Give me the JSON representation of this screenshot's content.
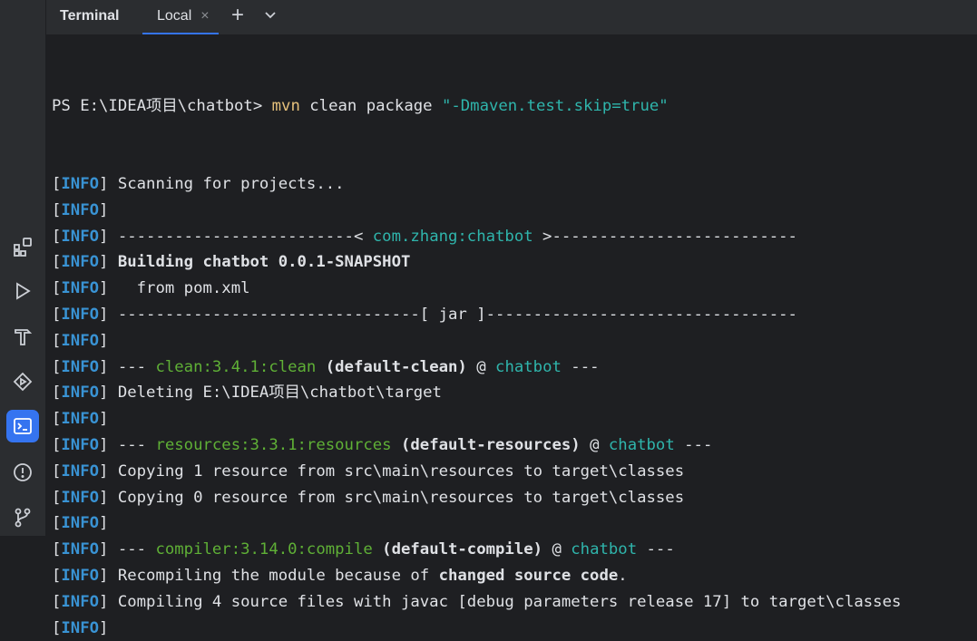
{
  "toolbar": {
    "title": "Terminal",
    "tab_label": "Local",
    "tab_close": "×",
    "add": "+"
  },
  "sidebar": {
    "items": [
      {
        "icon": "structure-icon"
      },
      {
        "icon": "run-icon"
      },
      {
        "icon": "build-icon"
      },
      {
        "icon": "services-icon"
      },
      {
        "icon": "terminal-icon",
        "active": true
      },
      {
        "icon": "problems-icon"
      },
      {
        "icon": "git-icon"
      }
    ]
  },
  "terminal": {
    "prompt": "PS E:\\IDEA项目\\chatbot>",
    "cmd": "mvn",
    "cmd_args": "clean package",
    "cmd_flag": "\"-Dmaven.test.skip=true\"",
    "lines": [
      {
        "tag": "INFO",
        "segments": [
          {
            "t": "Scanning for projects...",
            "c": "n"
          }
        ]
      },
      {
        "tag": "INFO",
        "segments": []
      },
      {
        "tag": "INFO",
        "segments": [
          {
            "t": "-------------------------< ",
            "c": "n"
          },
          {
            "t": "com.zhang:chatbot",
            "c": "cyan"
          },
          {
            "t": " >--------------------------",
            "c": "n"
          }
        ]
      },
      {
        "tag": "INFO",
        "segments": [
          {
            "t": "Building chatbot 0.0.1-SNAPSHOT",
            "c": "b"
          }
        ]
      },
      {
        "tag": "INFO",
        "segments": [
          {
            "t": "  from pom.xml",
            "c": "n"
          }
        ]
      },
      {
        "tag": "INFO",
        "segments": [
          {
            "t": "--------------------------------[ jar ]---------------------------------",
            "c": "n"
          }
        ]
      },
      {
        "tag": "INFO",
        "segments": []
      },
      {
        "tag": "INFO",
        "segments": [
          {
            "t": "--- ",
            "c": "n"
          },
          {
            "t": "clean:3.4.1:clean",
            "c": "grn"
          },
          {
            "t": " ",
            "c": "n"
          },
          {
            "t": "(default-clean)",
            "c": "b"
          },
          {
            "t": " @ ",
            "c": "n"
          },
          {
            "t": "chatbot",
            "c": "cyan"
          },
          {
            "t": " ---",
            "c": "n"
          }
        ]
      },
      {
        "tag": "INFO",
        "segments": [
          {
            "t": "Deleting E:\\IDEA项目\\chatbot\\target",
            "c": "n"
          }
        ]
      },
      {
        "tag": "INFO",
        "segments": []
      },
      {
        "tag": "INFO",
        "segments": [
          {
            "t": "--- ",
            "c": "n"
          },
          {
            "t": "resources:3.3.1:resources",
            "c": "grn"
          },
          {
            "t": " ",
            "c": "n"
          },
          {
            "t": "(default-resources)",
            "c": "b"
          },
          {
            "t": " @ ",
            "c": "n"
          },
          {
            "t": "chatbot",
            "c": "cyan"
          },
          {
            "t": " ---",
            "c": "n"
          }
        ]
      },
      {
        "tag": "INFO",
        "segments": [
          {
            "t": "Copying 1 resource from src\\main\\resources to target\\classes",
            "c": "n"
          }
        ]
      },
      {
        "tag": "INFO",
        "segments": [
          {
            "t": "Copying 0 resource from src\\main\\resources to target\\classes",
            "c": "n"
          }
        ]
      },
      {
        "tag": "INFO",
        "segments": []
      },
      {
        "tag": "INFO",
        "segments": [
          {
            "t": "--- ",
            "c": "n"
          },
          {
            "t": "compiler:3.14.0:compile",
            "c": "grn"
          },
          {
            "t": " ",
            "c": "n"
          },
          {
            "t": "(default-compile)",
            "c": "b"
          },
          {
            "t": " @ ",
            "c": "n"
          },
          {
            "t": "chatbot",
            "c": "cyan"
          },
          {
            "t": " ---",
            "c": "n"
          }
        ]
      },
      {
        "tag": "INFO",
        "segments": [
          {
            "t": "Recompiling the module because of ",
            "c": "n"
          },
          {
            "t": "changed source code",
            "c": "b"
          },
          {
            "t": ".",
            "c": "n"
          }
        ]
      },
      {
        "tag": "INFO",
        "segments": [
          {
            "t": "Compiling 4 source files with javac [debug parameters release 17] to target\\classes",
            "c": "n"
          }
        ]
      },
      {
        "tag": "INFO",
        "segments": []
      }
    ]
  }
}
